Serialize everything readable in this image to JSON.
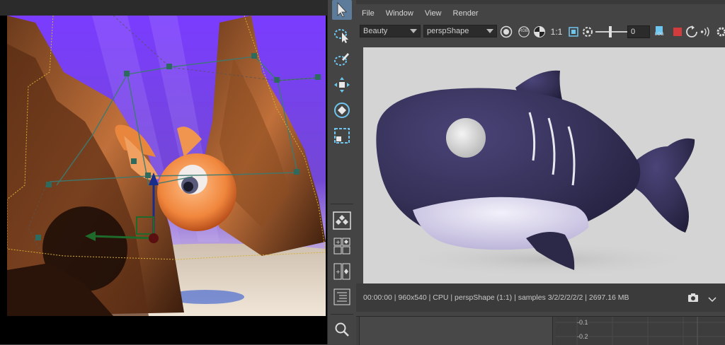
{
  "menubar": {
    "items": [
      "File",
      "Window",
      "View",
      "Render"
    ]
  },
  "toolbar": {
    "aov_dropdown": "Beauty",
    "camera_dropdown": "perspShape",
    "rgb_label": "RGB",
    "ratio_label": "1:1",
    "exposure_value": "0",
    "log_label": "LOG"
  },
  "status": {
    "text": "00:00:00 | 960x540 | CPU | perspShape (1:1) | samples 3/2/2/2/2/2 | 2697.16 MB"
  },
  "graph": {
    "ticks": [
      "-0.1",
      "-0.2"
    ]
  },
  "colors": {
    "tool_active": "#5d7b9a",
    "tool_icon": "#6ec6ef",
    "stop_red": "#d33c3c",
    "shark_body": "#343056",
    "shark_belly": "#d8d4ec"
  }
}
